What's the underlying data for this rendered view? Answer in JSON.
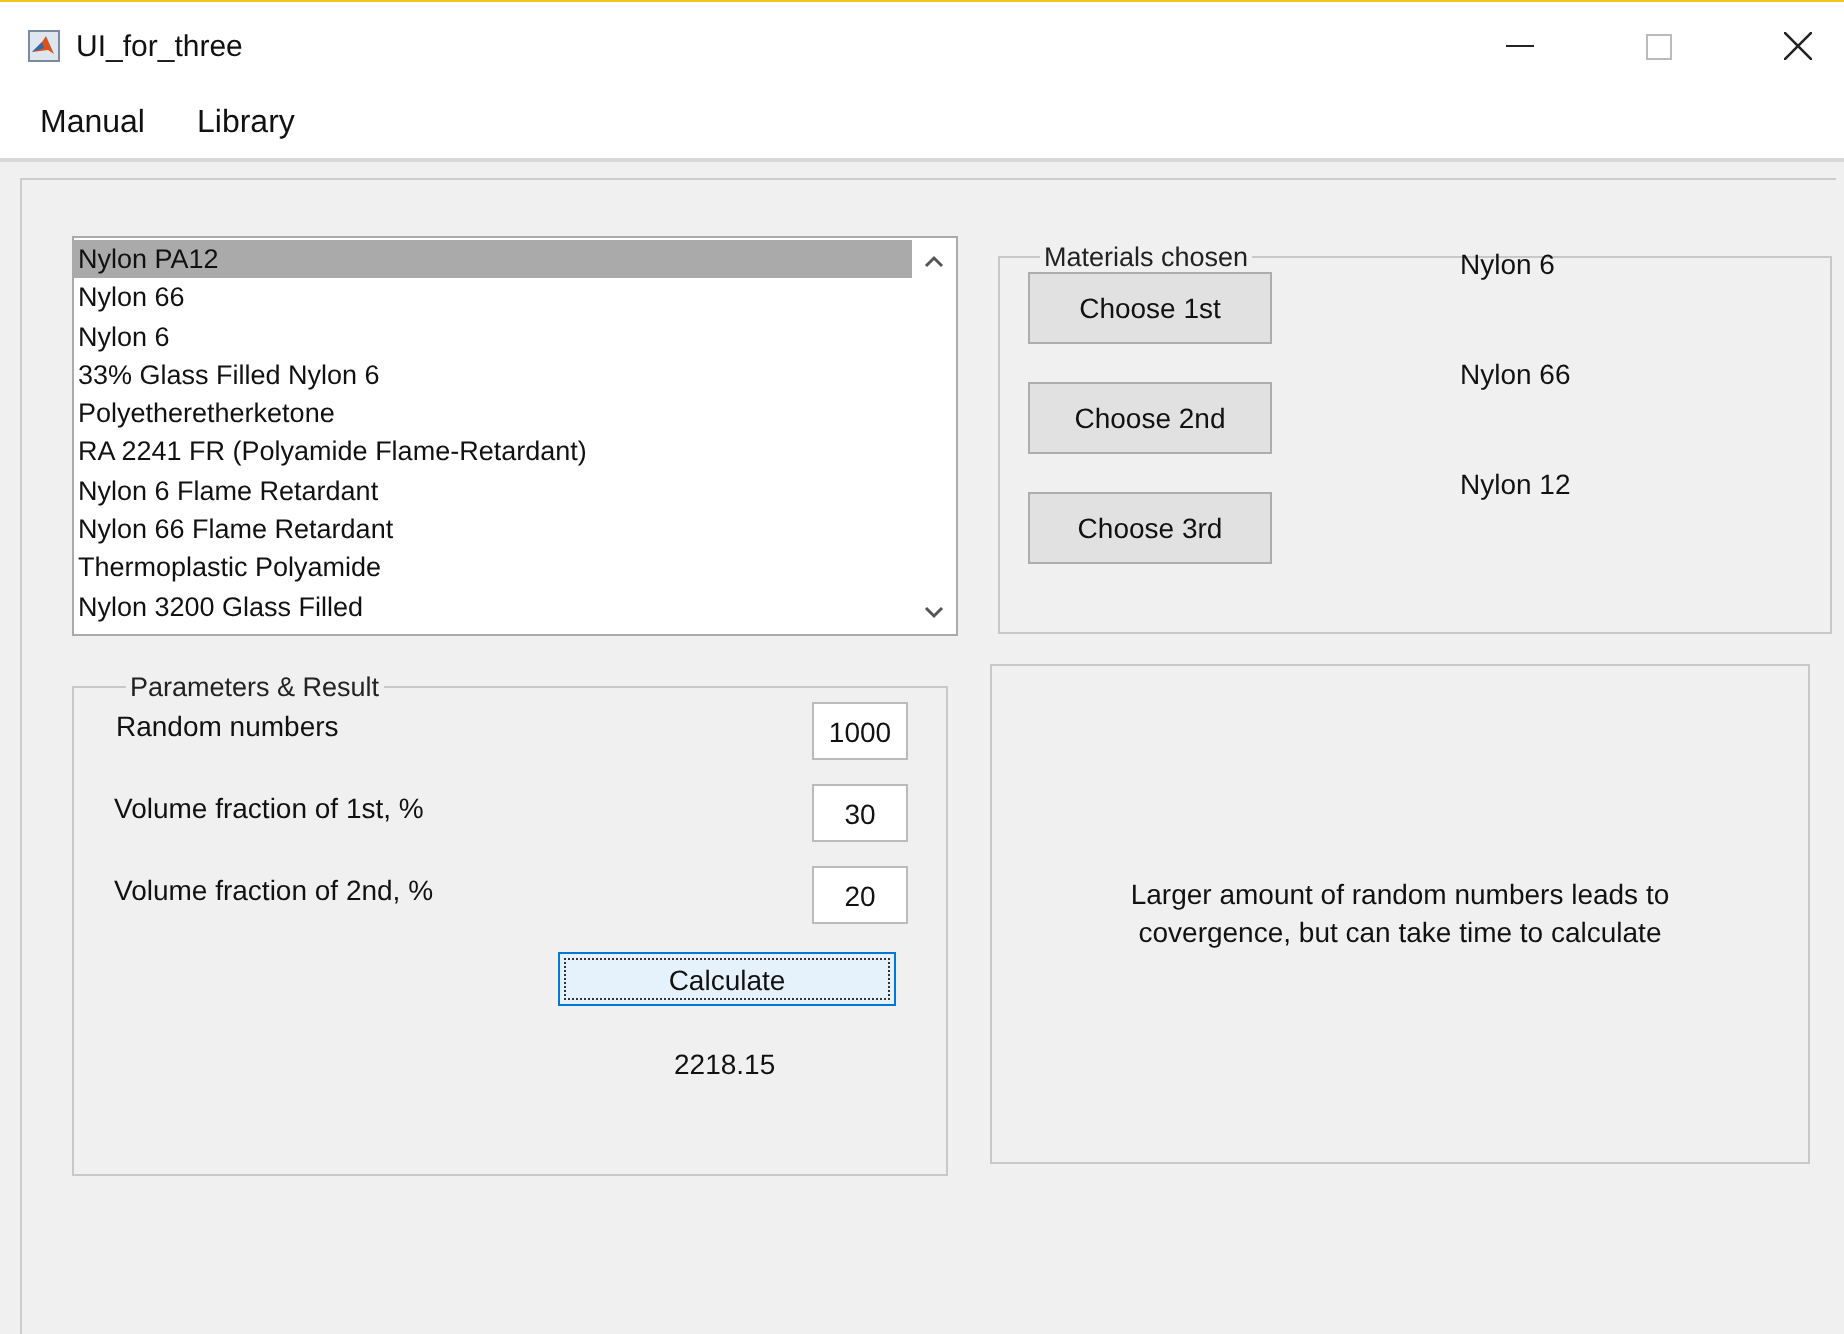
{
  "window": {
    "title": "UI_for_three"
  },
  "menu": [
    {
      "label": "Manual"
    },
    {
      "label": "Library"
    }
  ],
  "materials_list": [
    {
      "label": "Nylon PA12",
      "selected": true
    },
    {
      "label": "Nylon 66",
      "selected": false
    },
    {
      "label": "Nylon 6",
      "selected": false
    },
    {
      "label": "33% Glass Filled Nylon 6",
      "selected": false
    },
    {
      "label": "Polyetheretherketone",
      "selected": false
    },
    {
      "label": "RA 2241 FR (Polyamide Flame-Retardant)",
      "selected": false
    },
    {
      "label": "Nylon 6 Flame Retardant",
      "selected": false
    },
    {
      "label": "Nylon 66 Flame Retardant",
      "selected": false
    },
    {
      "label": "Thermoplastic Polyamide",
      "selected": false
    },
    {
      "label": "Nylon 3200 Glass Filled",
      "selected": false
    }
  ],
  "materials_chosen": {
    "title": "Materials chosen",
    "rows": [
      {
        "button": "Choose 1st",
        "value": "Nylon 6"
      },
      {
        "button": "Choose 2nd",
        "value": "Nylon 66"
      },
      {
        "button": "Choose 3rd",
        "value": "Nylon 12"
      }
    ]
  },
  "parameters": {
    "title": "Parameters & Result",
    "fields": [
      {
        "label": "Random numbers",
        "value": "1000"
      },
      {
        "label": "Volume fraction of 1st, %",
        "value": "30"
      },
      {
        "label": "Volume fraction of 2nd, %",
        "value": "20"
      }
    ],
    "calculate_button": "Calculate",
    "result": "2218.15"
  },
  "note": {
    "lines": [
      "Larger amount of random numbers leads to",
      "covergence, but can take time to calculate"
    ]
  }
}
